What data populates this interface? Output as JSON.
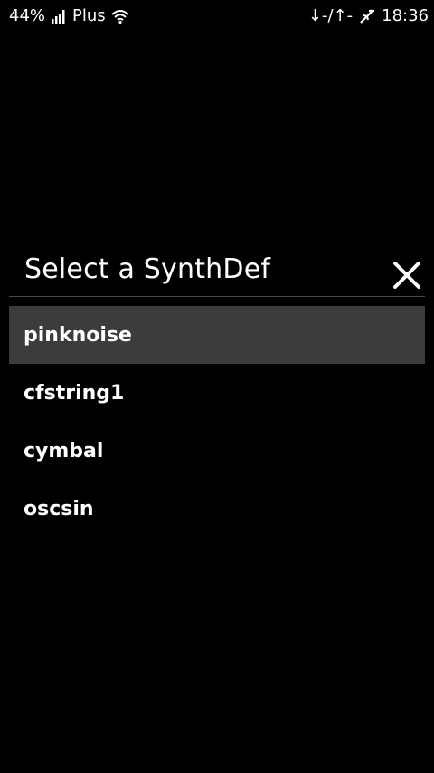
{
  "status_bar": {
    "battery": "44%",
    "carrier": "Plus",
    "data_activity": "↓-/↑-",
    "time": "18:36"
  },
  "icons": {
    "signal": "signal-strength-icon",
    "wifi": "wifi-icon",
    "usb": "usb-icon",
    "close": "close-icon"
  },
  "colors": {
    "background": "#000000",
    "selected_row": "#3c3c3c",
    "divider": "#4a4a4a",
    "text": "#ffffff"
  },
  "dialog": {
    "title": "Select a SynthDef",
    "selected_index": 0,
    "items": [
      {
        "label": "pinknoise"
      },
      {
        "label": "cfstring1"
      },
      {
        "label": "cymbal"
      },
      {
        "label": "oscsin"
      }
    ]
  }
}
